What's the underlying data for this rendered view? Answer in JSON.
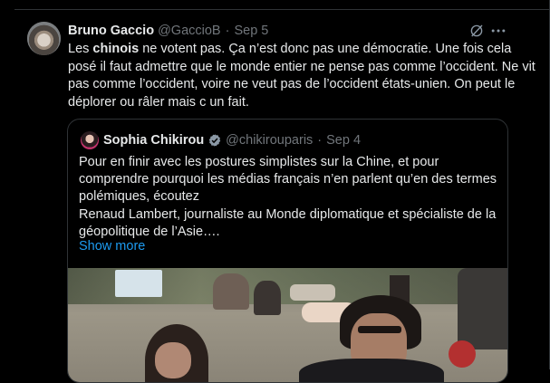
{
  "tweet": {
    "author_name": "Bruno Gaccio",
    "author_handle": "@GaccioB",
    "separator": "·",
    "date": "Sep 5",
    "text_pre": "Les ",
    "text_bold": "chinois",
    "text_post": " ne votent pas. Ça n’est donc pas une démocratie. Une fois cela posé il faut admettre que le monde entier ne pense pas comme l’occident. Ne vit pas comme l’occident, voire ne veut pas de l’occident états-unien. On peut le déplorer ou râler mais c un fait."
  },
  "quote": {
    "author_name": "Sophia Chikirou",
    "author_handle": "@chikirouparis",
    "separator": "·",
    "date": "Sep 4",
    "text": "Pour en finir avec les postures simplistes sur la Chine, et pour comprendre pourquoi les médias français n’en parlent qu’en des termes polémiques, écoutez\nRenaud Lambert, journaliste au Monde diplomatique et spécialiste de la géopolitique de l’Asie….",
    "show_more": "Show more"
  },
  "colors": {
    "background": "#000000",
    "text": "#e7e9ea",
    "secondary": "#71767b",
    "link": "#1d9bf0",
    "border": "#2f3336"
  },
  "icons": [
    "grok-icon",
    "more-icon",
    "verified-badge-icon"
  ]
}
